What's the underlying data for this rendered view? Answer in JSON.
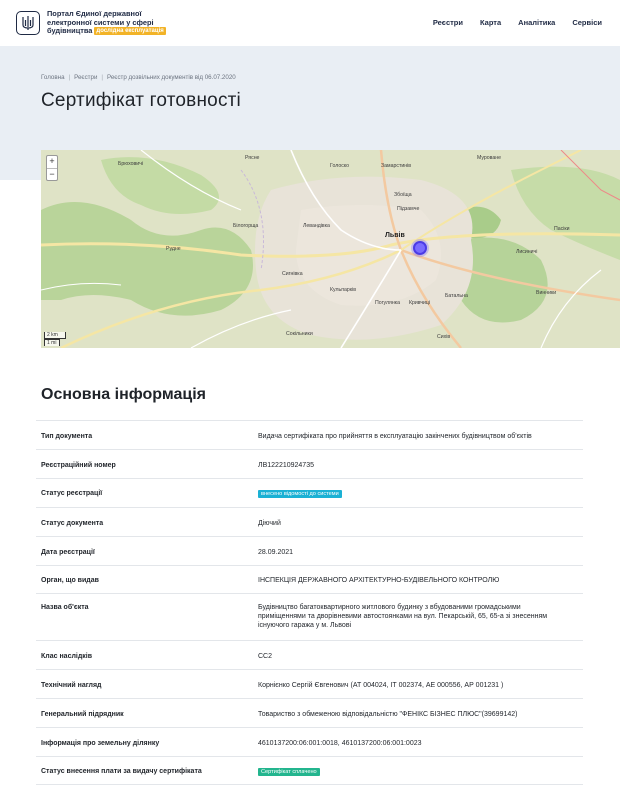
{
  "header": {
    "portal_title_line1": "Портал Єдиної державної",
    "portal_title_line2": "електронної системи у сфері",
    "portal_title_line3": "будівництва",
    "beta_label": "дослідна експлуатація",
    "nav": [
      "Реєстри",
      "Карта",
      "Аналітика",
      "Сервіси"
    ]
  },
  "breadcrumb": [
    "Головна",
    "Реєстри",
    "Реєстр дозвільних документів від 06.07.2020"
  ],
  "page_title": "Сертифікат готовності",
  "map": {
    "zoom_in": "+",
    "zoom_out": "−",
    "scale_km": "2 km",
    "scale_mi": "1 mi",
    "labels": {
      "city": "Львів",
      "rudne": "Рудне",
      "bilohorshcha": "Білогорща",
      "levandivka": "Левандівка",
      "sykhiv": "Сихів",
      "vynnyky": "Винники",
      "lysynychi": "Лисиничі",
      "zamarstyniv": "Замарстинів",
      "holosko": "Голоско",
      "ryasne": "Рясне",
      "bryukhovychi": "Брюховичі",
      "sokilnyky": "Сокільники",
      "zboyishcha": "Збоїща",
      "pidzamche": "Підзамче",
      "kryvchytsi": "Кривчиці",
      "sygnivka": "Сигнівка",
      "kulparkiv": "Кульпарків",
      "batalna": "Батальна",
      "pasiky": "Пасіки",
      "pogulyanka": "Погулянка",
      "murovane": "Муроване"
    }
  },
  "section_title": "Основна інформація",
  "rows": [
    {
      "key": "Тип документа",
      "value": "Видача сертифіката про прийняття в експлуатацію закінчених будівництвом об'єктів"
    },
    {
      "key": "Реєстраційний номер",
      "value": "ЛВ122210924735"
    },
    {
      "key": "Статус реєстрації",
      "badge": "внесено відомості до системи",
      "badge_color": "#1bb1d4"
    },
    {
      "key": "Статус документа",
      "value": "Діючий"
    },
    {
      "key": "Дата реєстрації",
      "value": "28.09.2021"
    },
    {
      "key": "Орган, що видав",
      "value": "ІНСПЕКЦІЯ ДЕРЖАВНОГО АРХІТЕКТУРНО-БУДІВЕЛЬНОГО КОНТРОЛЮ"
    },
    {
      "key": "Назва об'єкта",
      "value": "Будівництво багатоквартирного житлового будинку з вбудованими громадськими приміщеннями та дворівневими автостоянками на вул. Пекарській, 65, 65-а зі знесенням існуючого гаража у м. Львові"
    },
    {
      "key": "Клас наслідків",
      "value": "СС2"
    },
    {
      "key": "Технічний нагляд",
      "value": "Корнієнко Сергій Євгенович (АТ 004024, ІТ 002374, АЕ 000556, АР 001231 )"
    },
    {
      "key": "Генеральний підрядник",
      "value": "Товариство з обмеженою відповідальністю \"ФЕНІКС БІЗНЕС ПЛЮС\"(39699142)"
    },
    {
      "key": "Інформація про земельну ділянку",
      "value": "4610137200:06:001:0018, 4610137200:06:001:0023"
    },
    {
      "key": "Статус внесення плати за видачу сертифіката",
      "badge": "Сертифікат сплачено",
      "badge_color": "#23b58e"
    }
  ]
}
